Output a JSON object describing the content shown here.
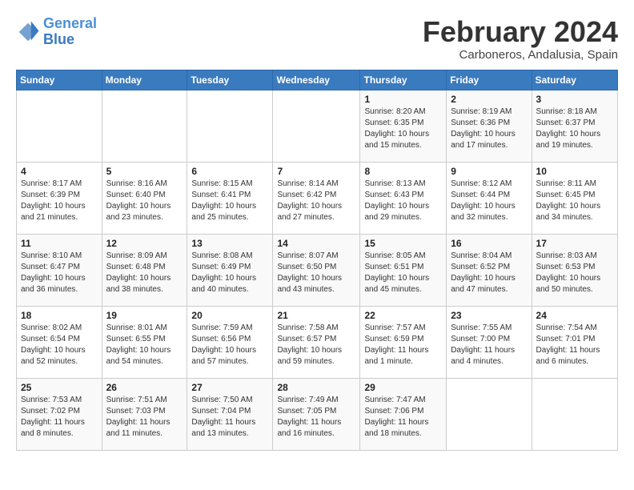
{
  "header": {
    "logo_line1": "General",
    "logo_line2": "Blue",
    "title": "February 2024",
    "location": "Carboneros, Andalusia, Spain"
  },
  "weekdays": [
    "Sunday",
    "Monday",
    "Tuesday",
    "Wednesday",
    "Thursday",
    "Friday",
    "Saturday"
  ],
  "weeks": [
    [
      {
        "day": "",
        "info": ""
      },
      {
        "day": "",
        "info": ""
      },
      {
        "day": "",
        "info": ""
      },
      {
        "day": "",
        "info": ""
      },
      {
        "day": "1",
        "info": "Sunrise: 8:20 AM\nSunset: 6:35 PM\nDaylight: 10 hours\nand 15 minutes."
      },
      {
        "day": "2",
        "info": "Sunrise: 8:19 AM\nSunset: 6:36 PM\nDaylight: 10 hours\nand 17 minutes."
      },
      {
        "day": "3",
        "info": "Sunrise: 8:18 AM\nSunset: 6:37 PM\nDaylight: 10 hours\nand 19 minutes."
      }
    ],
    [
      {
        "day": "4",
        "info": "Sunrise: 8:17 AM\nSunset: 6:39 PM\nDaylight: 10 hours\nand 21 minutes."
      },
      {
        "day": "5",
        "info": "Sunrise: 8:16 AM\nSunset: 6:40 PM\nDaylight: 10 hours\nand 23 minutes."
      },
      {
        "day": "6",
        "info": "Sunrise: 8:15 AM\nSunset: 6:41 PM\nDaylight: 10 hours\nand 25 minutes."
      },
      {
        "day": "7",
        "info": "Sunrise: 8:14 AM\nSunset: 6:42 PM\nDaylight: 10 hours\nand 27 minutes."
      },
      {
        "day": "8",
        "info": "Sunrise: 8:13 AM\nSunset: 6:43 PM\nDaylight: 10 hours\nand 29 minutes."
      },
      {
        "day": "9",
        "info": "Sunrise: 8:12 AM\nSunset: 6:44 PM\nDaylight: 10 hours\nand 32 minutes."
      },
      {
        "day": "10",
        "info": "Sunrise: 8:11 AM\nSunset: 6:45 PM\nDaylight: 10 hours\nand 34 minutes."
      }
    ],
    [
      {
        "day": "11",
        "info": "Sunrise: 8:10 AM\nSunset: 6:47 PM\nDaylight: 10 hours\nand 36 minutes."
      },
      {
        "day": "12",
        "info": "Sunrise: 8:09 AM\nSunset: 6:48 PM\nDaylight: 10 hours\nand 38 minutes."
      },
      {
        "day": "13",
        "info": "Sunrise: 8:08 AM\nSunset: 6:49 PM\nDaylight: 10 hours\nand 40 minutes."
      },
      {
        "day": "14",
        "info": "Sunrise: 8:07 AM\nSunset: 6:50 PM\nDaylight: 10 hours\nand 43 minutes."
      },
      {
        "day": "15",
        "info": "Sunrise: 8:05 AM\nSunset: 6:51 PM\nDaylight: 10 hours\nand 45 minutes."
      },
      {
        "day": "16",
        "info": "Sunrise: 8:04 AM\nSunset: 6:52 PM\nDaylight: 10 hours\nand 47 minutes."
      },
      {
        "day": "17",
        "info": "Sunrise: 8:03 AM\nSunset: 6:53 PM\nDaylight: 10 hours\nand 50 minutes."
      }
    ],
    [
      {
        "day": "18",
        "info": "Sunrise: 8:02 AM\nSunset: 6:54 PM\nDaylight: 10 hours\nand 52 minutes."
      },
      {
        "day": "19",
        "info": "Sunrise: 8:01 AM\nSunset: 6:55 PM\nDaylight: 10 hours\nand 54 minutes."
      },
      {
        "day": "20",
        "info": "Sunrise: 7:59 AM\nSunset: 6:56 PM\nDaylight: 10 hours\nand 57 minutes."
      },
      {
        "day": "21",
        "info": "Sunrise: 7:58 AM\nSunset: 6:57 PM\nDaylight: 10 hours\nand 59 minutes."
      },
      {
        "day": "22",
        "info": "Sunrise: 7:57 AM\nSunset: 6:59 PM\nDaylight: 11 hours\nand 1 minute."
      },
      {
        "day": "23",
        "info": "Sunrise: 7:55 AM\nSunset: 7:00 PM\nDaylight: 11 hours\nand 4 minutes."
      },
      {
        "day": "24",
        "info": "Sunrise: 7:54 AM\nSunset: 7:01 PM\nDaylight: 11 hours\nand 6 minutes."
      }
    ],
    [
      {
        "day": "25",
        "info": "Sunrise: 7:53 AM\nSunset: 7:02 PM\nDaylight: 11 hours\nand 8 minutes."
      },
      {
        "day": "26",
        "info": "Sunrise: 7:51 AM\nSunset: 7:03 PM\nDaylight: 11 hours\nand 11 minutes."
      },
      {
        "day": "27",
        "info": "Sunrise: 7:50 AM\nSunset: 7:04 PM\nDaylight: 11 hours\nand 13 minutes."
      },
      {
        "day": "28",
        "info": "Sunrise: 7:49 AM\nSunset: 7:05 PM\nDaylight: 11 hours\nand 16 minutes."
      },
      {
        "day": "29",
        "info": "Sunrise: 7:47 AM\nSunset: 7:06 PM\nDaylight: 11 hours\nand 18 minutes."
      },
      {
        "day": "",
        "info": ""
      },
      {
        "day": "",
        "info": ""
      }
    ]
  ]
}
